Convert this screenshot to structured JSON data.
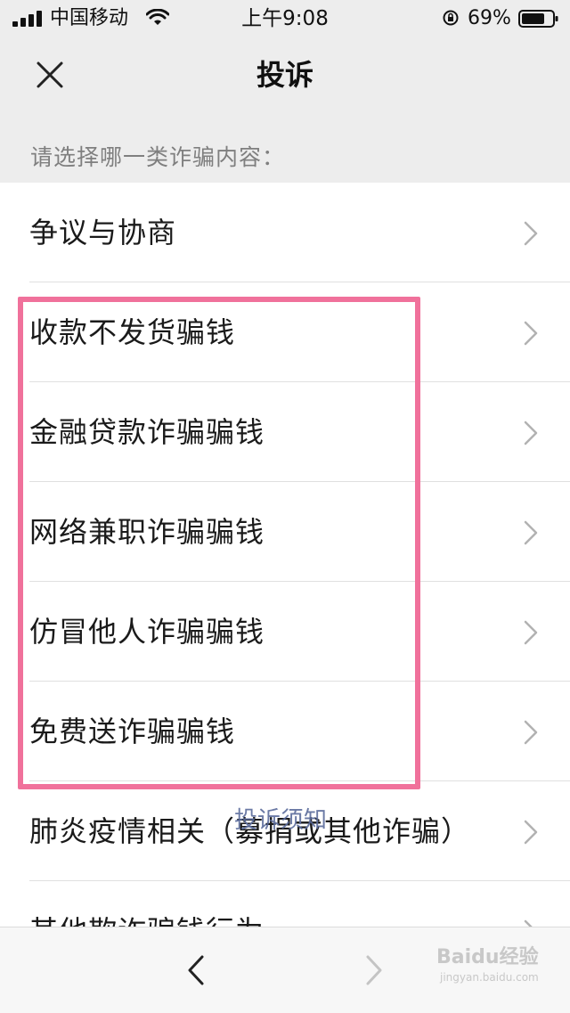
{
  "status_bar": {
    "carrier": "中国移动",
    "time": "上午9:08",
    "battery": "69%"
  },
  "nav": {
    "title": "投诉"
  },
  "section_header": "请选择哪一类诈骗内容：",
  "list_items": [
    {
      "label": "争议与协商"
    },
    {
      "label": "收款不发货骗钱"
    },
    {
      "label": "金融贷款诈骗骗钱"
    },
    {
      "label": "网络兼职诈骗骗钱"
    },
    {
      "label": "仿冒他人诈骗骗钱"
    },
    {
      "label": "免费送诈骗骗钱"
    },
    {
      "label": "肺炎疫情相关（募捐或其他诈骗）"
    },
    {
      "label": "其他欺诈骗钱行为"
    }
  ],
  "overlay_link": "投诉须知",
  "watermark": {
    "main": "Baidu经验",
    "sub": "jingyan.baidu.com"
  },
  "colors": {
    "highlight": "#f0719b",
    "background": "#ededed",
    "list_bg": "#ffffff"
  },
  "icons": {
    "close": "close-icon",
    "chevron": "chevron-right-icon",
    "back": "back-arrow-icon",
    "forward": "forward-arrow-icon"
  }
}
